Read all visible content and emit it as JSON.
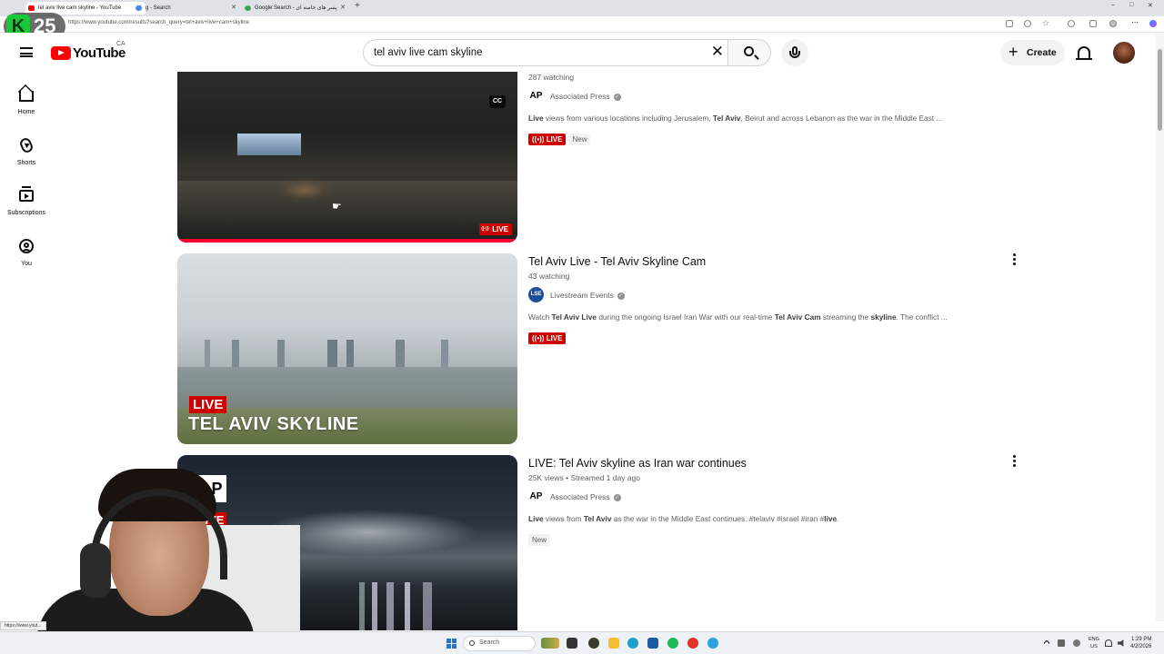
{
  "browser": {
    "tabs": [
      {
        "title": "tel aviv live cam skyline - YouTube",
        "active": true,
        "favicon_color": "#ff0000"
      },
      {
        "title": "g - Search",
        "active": false,
        "favicon_color": "#4285f4"
      },
      {
        "title": "Google Search - پسر های خامنه ای",
        "active": false,
        "favicon_color": "#34a853"
      }
    ],
    "url": "https://www.youtube.com/results?search_query=tel+aviv+live+cam+skyline",
    "status_url": "https://www.yout..."
  },
  "overlay_badge": {
    "letter": "K",
    "number": "25"
  },
  "header": {
    "logo_text": "YouTube",
    "country": "CA",
    "search_query": "tel aviv live cam skyline",
    "create_label": "Create",
    "icons": [
      "menu-icon",
      "search-icon",
      "mic-icon",
      "bell-icon",
      "avatar"
    ]
  },
  "sidebar": {
    "items": [
      {
        "label": "Home",
        "icon": "home-icon"
      },
      {
        "label": "Shorts",
        "icon": "shorts-icon"
      },
      {
        "label": "Subscriptions",
        "icon": "subscriptions-icon"
      },
      {
        "label": "You",
        "icon": "you-icon"
      }
    ]
  },
  "results": [
    {
      "title": "",
      "stats": "287 watching",
      "channel": "Associated Press",
      "channel_badge": "AP",
      "verified": true,
      "description_parts": [
        {
          "text": "Live",
          "bold": true
        },
        {
          "text": " views from various locations including Jerusalem, ",
          "bold": false
        },
        {
          "text": "Tel Aviv",
          "bold": true
        },
        {
          "text": ", Beirut and across Lebanon as the war in the Middle East ...",
          "bold": false
        }
      ],
      "live_label": "LIVE",
      "new_label": "New",
      "thumb_live_label": "LIVE",
      "cc_label": "CC"
    },
    {
      "title": "Tel Aviv Live - Tel Aviv Skyline Cam",
      "stats": "43 watching",
      "channel": "Livestream Events",
      "channel_badge": "LSE",
      "verified": true,
      "description_parts": [
        {
          "text": "Watch ",
          "bold": false
        },
        {
          "text": "Tel Aviv Live",
          "bold": true
        },
        {
          "text": " during the ongoing Israel Iran War with our real-time ",
          "bold": false
        },
        {
          "text": "Tel Aviv Cam",
          "bold": true
        },
        {
          "text": " streaming the ",
          "bold": false
        },
        {
          "text": "skyline",
          "bold": true
        },
        {
          "text": ". The conflict ...",
          "bold": false
        }
      ],
      "live_label": "LIVE",
      "thumb_overlay_live": "LIVE",
      "thumb_overlay_title": "TEL AVIV SKYLINE"
    },
    {
      "title": "LIVE: Tel Aviv skyline as Iran war continues",
      "stats": "25K views • Streamed 1 day ago",
      "channel": "Associated Press",
      "channel_badge": "AP",
      "verified": true,
      "description_parts": [
        {
          "text": "Live",
          "bold": true
        },
        {
          "text": " views from ",
          "bold": false
        },
        {
          "text": "Tel Aviv",
          "bold": true
        },
        {
          "text": " as the war in the Middle East continues. #telaviv #israel #iran #",
          "bold": false
        },
        {
          "text": "live",
          "bold": true
        },
        {
          "text": ".",
          "bold": false
        }
      ],
      "new_label": "New",
      "thumb_ap": "AP",
      "thumb_ap_live": "LIVE"
    }
  ],
  "taskbar": {
    "search_placeholder": "Search",
    "lang_line1": "ENG",
    "lang_line2": "US",
    "time": "1:29 PM",
    "date": "4/2/2026"
  },
  "colors": {
    "youtube_red": "#ff0000",
    "live_red": "#cc0000",
    "progress_red": "#ff0033",
    "text_primary": "#0f0f0f",
    "text_secondary": "#606060"
  }
}
